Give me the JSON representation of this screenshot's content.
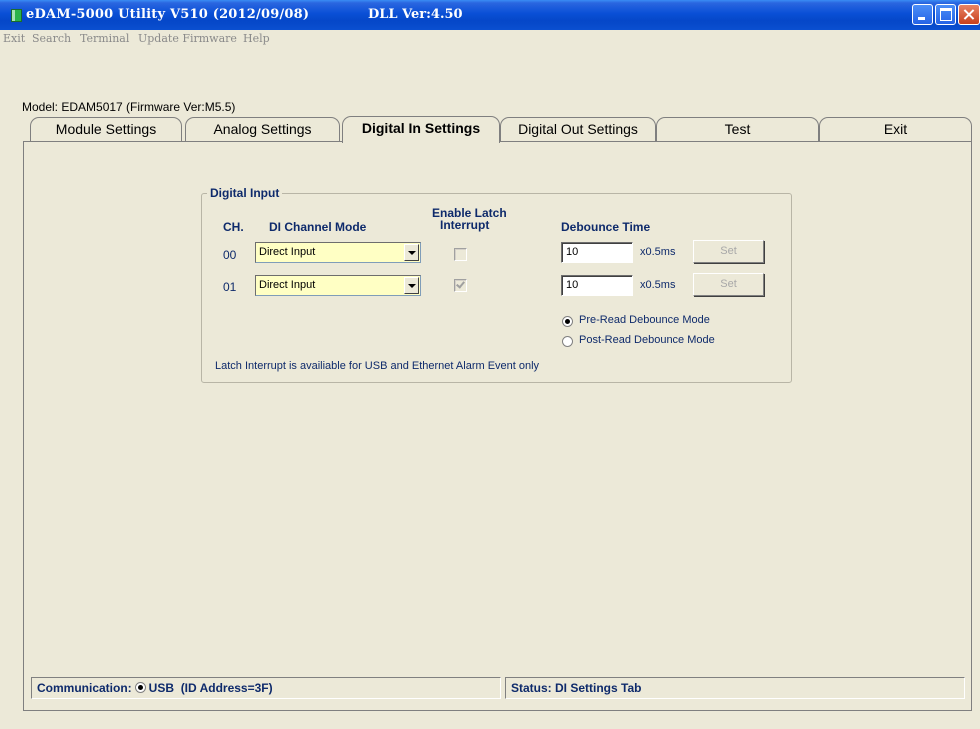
{
  "window": {
    "title": "eDAM-5000 Utility  V510 (2012/09/08)",
    "dll_version": "DLL Ver:4.50"
  },
  "menu": [
    "Exit",
    "Search",
    "Terminal",
    "Update Firmware",
    "Help"
  ],
  "model_label": "Model: EDAM5017 (Firmware Ver:M5.5)",
  "tabs": [
    {
      "label": "Module Settings",
      "active": false
    },
    {
      "label": "Analog Settings",
      "active": false
    },
    {
      "label": "Digital In Settings",
      "active": true
    },
    {
      "label": "Digital Out Settings",
      "active": false
    },
    {
      "label": "Test",
      "active": false
    },
    {
      "label": "Exit",
      "active": false
    }
  ],
  "digital_input": {
    "group_title": "Digital Input",
    "headers": {
      "channel": "CH.",
      "mode": "DI Channel Mode",
      "latch_line1": "Enable Latch",
      "latch_line2": "Interrupt",
      "debounce": "Debounce Time"
    },
    "channels": [
      {
        "ch": "00",
        "mode": "Direct Input",
        "latch_checked": false,
        "debounce": "10",
        "unit": "x0.5ms",
        "set_label": "Set"
      },
      {
        "ch": "01",
        "mode": "Direct Input",
        "latch_checked": true,
        "debounce": "10",
        "unit": "x0.5ms",
        "set_label": "Set"
      }
    ],
    "debounce_modes": [
      {
        "label": "Pre-Read Debounce Mode",
        "selected": true
      },
      {
        "label": "Post-Read Debounce Mode",
        "selected": false
      }
    ],
    "note": "Latch Interrupt is availiable for USB and Ethernet Alarm Event only"
  },
  "status_bar": {
    "comm_label": "Communication:",
    "comm_value": "USB",
    "id_address": "(ID Address=3F)",
    "status": "Status: DI Settings Tab"
  }
}
